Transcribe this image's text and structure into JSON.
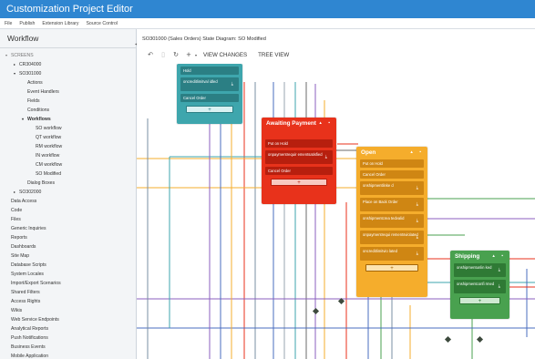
{
  "app": {
    "title": "Customization Project Editor"
  },
  "menu": [
    "File",
    "Publish",
    "Extension Library",
    "Source Control"
  ],
  "sidebar": {
    "title": "Workflow",
    "collapse_icon": "chevron-left-icon",
    "tree": [
      {
        "label": "SCREENS",
        "level": 0,
        "toggle": "▾",
        "header": true
      },
      {
        "label": "CR304000",
        "level": 1,
        "toggle": "▸"
      },
      {
        "label": "SO301000",
        "level": 1,
        "toggle": "▾"
      },
      {
        "label": "Actions",
        "level": 2,
        "toggle": ""
      },
      {
        "label": "Event Handlers",
        "level": 2,
        "toggle": ""
      },
      {
        "label": "Fields",
        "level": 2,
        "toggle": ""
      },
      {
        "label": "Conditions",
        "level": 2,
        "toggle": ""
      },
      {
        "label": "Workflows",
        "level": 2,
        "toggle": "▾",
        "bold": true
      },
      {
        "label": "SO workflow",
        "level": 3,
        "toggle": ""
      },
      {
        "label": "QT workflow",
        "level": 3,
        "toggle": ""
      },
      {
        "label": "RM workflow",
        "level": 3,
        "toggle": ""
      },
      {
        "label": "IN workflow",
        "level": 3,
        "toggle": ""
      },
      {
        "label": "CM workflow",
        "level": 3,
        "toggle": ""
      },
      {
        "label": "SO Modified",
        "level": 3,
        "toggle": ""
      },
      {
        "label": "Dialog Boxes",
        "level": 2,
        "toggle": ""
      },
      {
        "label": "SO302000",
        "level": 1,
        "toggle": "▸"
      },
      {
        "label": "Data Access",
        "level": 0,
        "toggle": ""
      },
      {
        "label": "Code",
        "level": 0,
        "toggle": ""
      },
      {
        "label": "Files",
        "level": 0,
        "toggle": ""
      },
      {
        "label": "Generic Inquiries",
        "level": 0,
        "toggle": ""
      },
      {
        "label": "Reports",
        "level": 0,
        "toggle": ""
      },
      {
        "label": "Dashboards",
        "level": 0,
        "toggle": ""
      },
      {
        "label": "Site Map",
        "level": 0,
        "toggle": ""
      },
      {
        "label": "Database Scripts",
        "level": 0,
        "toggle": ""
      },
      {
        "label": "System Locales",
        "level": 0,
        "toggle": ""
      },
      {
        "label": "Import/Export Scenarios",
        "level": 0,
        "toggle": ""
      },
      {
        "label": "Shared Filters",
        "level": 0,
        "toggle": ""
      },
      {
        "label": "Access Rights",
        "level": 0,
        "toggle": ""
      },
      {
        "label": "Wikis",
        "level": 0,
        "toggle": ""
      },
      {
        "label": "Web Service Endpoints",
        "level": 0,
        "toggle": ""
      },
      {
        "label": "Analytical Reports",
        "level": 0,
        "toggle": ""
      },
      {
        "label": "Push Notifications",
        "level": 0,
        "toggle": ""
      },
      {
        "label": "Business Events",
        "level": 0,
        "toggle": ""
      },
      {
        "label": "Mobile Application",
        "level": 0,
        "toggle": ""
      }
    ]
  },
  "main": {
    "breadcrumb": "SO301000 (Sales Orders) State Diagram: SO Modified",
    "toolbar": {
      "undo_icon": "undo-icon",
      "delete_icon": "trash-icon",
      "refresh_icon": "refresh-icon",
      "add_icon": "plus-icon",
      "view_changes": "VIEW CHANGES",
      "tree_view": "TREE VIEW"
    }
  },
  "diagram": {
    "states": [
      {
        "id": "hold",
        "title": "",
        "color": "teal",
        "actions": [
          "Hold",
          "oncreditlimitval idled",
          "Cancel Order"
        ]
      },
      {
        "id": "awaiting",
        "title": "Awaiting Payment",
        "color": "red",
        "actions": [
          "Put on Hold",
          "onpaymentrequir ementsatisfied",
          "Cancel Order"
        ]
      },
      {
        "id": "open",
        "title": "Open",
        "color": "orange",
        "actions": [
          "Put on Hold",
          "Cancel Order",
          "onshipmentlinke d",
          "Place on Back Order",
          "onshipmentcrea tedvalid",
          "onpaymentrequi rementsviolated",
          "oncreditlimitvio lated"
        ]
      },
      {
        "id": "shipping",
        "title": "Shipping",
        "color": "green",
        "actions": [
          "onshipmentunlin ked",
          "onshipmentconfi rmed"
        ]
      }
    ],
    "colors": {
      "teal": "#3ea6ad",
      "red": "#e8321b",
      "orange": "#f5ad2c",
      "green": "#49a14f"
    }
  }
}
